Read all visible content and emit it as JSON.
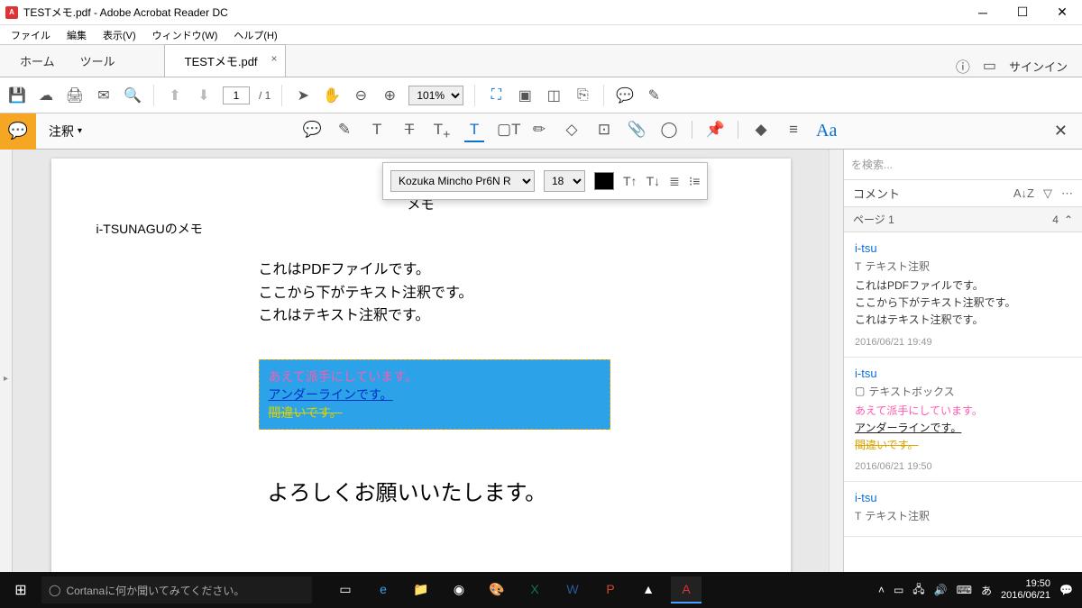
{
  "window": {
    "title": "TESTメモ.pdf - Adobe Acrobat Reader DC"
  },
  "menu": {
    "file": "ファイル",
    "edit": "編集",
    "view": "表示(V)",
    "window": "ウィンドウ(W)",
    "help": "ヘルプ(H)"
  },
  "tabs": {
    "home": "ホーム",
    "tools": "ツール",
    "doc": "TESTメモ.pdf",
    "signin": "サインイン"
  },
  "toolbar": {
    "page_current": "1",
    "page_total": "/ 1",
    "zoom": "101%"
  },
  "comment_toolbar": {
    "label": "注釈"
  },
  "font_popup": {
    "font": "Kozuka Mincho Pr6N R",
    "size": "18"
  },
  "document": {
    "memo_label": "メモ",
    "author_line": "i-TSUNAGUのメモ",
    "body_l1": "これはPDFファイルです。",
    "body_l2": "ここから下がテキスト注釈です。",
    "body_l3": "これはテキスト注釈です。",
    "box_l1": "あえて派手にしています。",
    "box_l2": "アンダーラインです。",
    "box_l3": "間違いです。",
    "closing": "よろしくお願いいたします。"
  },
  "rightpane": {
    "search_placeholder": "を検索...",
    "heading": "コメント",
    "sort": "A↓Z",
    "page_label": "ページ 1",
    "page_count": "4",
    "comments": [
      {
        "author": "i-tsu",
        "type": "テキスト注釈",
        "content": [
          "これはPDFファイルです。",
          "ここから下がテキスト注釈です。",
          "これはテキスト注釈です。"
        ],
        "timestamp": "2016/06/21  19:49"
      },
      {
        "author": "i-tsu",
        "type": "テキストボックス",
        "content_styled": {
          "l1": "あえて派手にしています。",
          "l2": "アンダーラインです。",
          "l3": "間違いです。"
        },
        "timestamp": "2016/06/21  19:50"
      },
      {
        "author": "i-tsu",
        "type": "テキスト注釈"
      }
    ]
  },
  "taskbar": {
    "cortana": "Cortanaに何か聞いてみてください。",
    "ime": "あ",
    "time": "19:50",
    "date": "2016/06/21"
  }
}
